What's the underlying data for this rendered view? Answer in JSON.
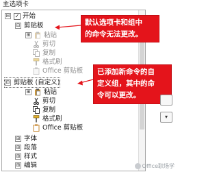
{
  "header": {
    "title": "主选项卡"
  },
  "tree": {
    "start": {
      "label": "开始",
      "checked": "✓",
      "toggle": "⊟"
    },
    "clipboard": {
      "label": "剪贴板",
      "toggle": "⊟",
      "items": [
        {
          "label": "粘贴",
          "toggle": "⊞",
          "icon": "paste-icon"
        },
        {
          "label": "剪切",
          "icon": "cut-icon"
        },
        {
          "label": "复制",
          "icon": "copy-icon"
        },
        {
          "label": "格式刷",
          "icon": "format-painter-icon"
        },
        {
          "label": "Office 剪贴板",
          "icon": "office-clipboard-icon"
        }
      ]
    },
    "custom_clipboard": {
      "label": "剪贴板 (自定义)",
      "toggle": "⊟",
      "items": [
        {
          "label": "粘贴",
          "toggle": "⊞",
          "icon": "paste-icon"
        },
        {
          "label": "剪切",
          "icon": "cut-icon"
        },
        {
          "label": "复制",
          "icon": "copy-icon"
        },
        {
          "label": "格式刷",
          "icon": "format-painter-icon"
        },
        {
          "label": "Office 剪贴板",
          "icon": "office-clipboard-icon"
        }
      ]
    },
    "groups": [
      {
        "label": "字体",
        "toggle": "⊞"
      },
      {
        "label": "段落",
        "toggle": "⊞"
      },
      {
        "label": "样式",
        "toggle": "⊞"
      },
      {
        "label": "编辑",
        "toggle": "⊞"
      }
    ]
  },
  "callouts": {
    "top": {
      "line1": "默认选项卡和组中",
      "line2": "的命令无法更改。"
    },
    "bottom": {
      "line1": "已添加新命令的自",
      "line2": "定义组，其中的命",
      "line3": "令可以更改。"
    }
  },
  "side_buttons": {
    "down": "▾"
  },
  "watermark": {
    "text": "Office职场学"
  },
  "colors": {
    "callout": "#e4141b",
    "arrow": "#e4141b"
  }
}
